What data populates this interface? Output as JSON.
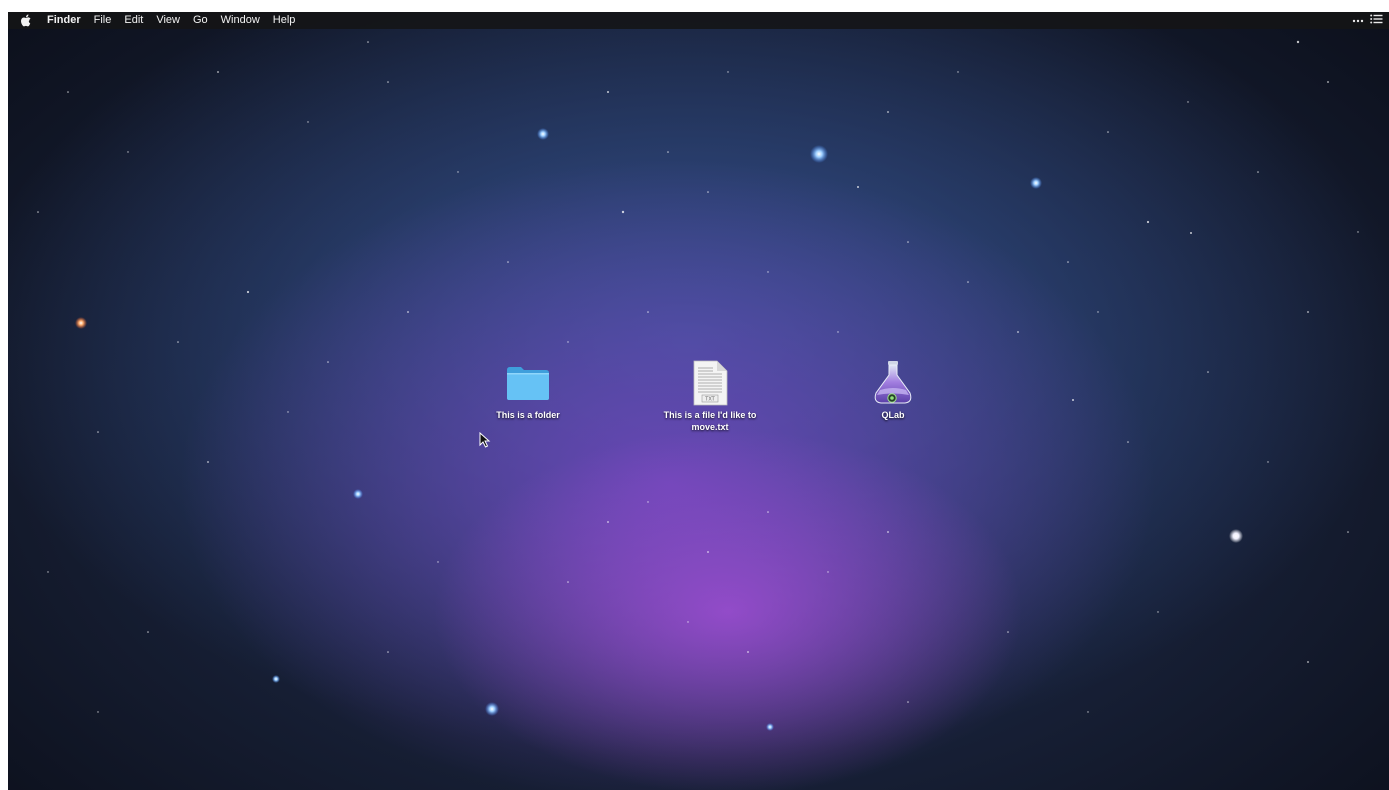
{
  "menubar": {
    "apple_icon": "apple-logo-icon",
    "items": [
      {
        "label": "Finder",
        "bold": true
      },
      {
        "label": "File"
      },
      {
        "label": "Edit"
      },
      {
        "label": "View"
      },
      {
        "label": "Go"
      },
      {
        "label": "Window"
      },
      {
        "label": "Help"
      }
    ],
    "right_icons": [
      "more-icon",
      "notification-center-icon"
    ]
  },
  "desktop": {
    "wallpaper": "galaxy-nebula",
    "items": [
      {
        "name": "This is a folder",
        "kind": "folder",
        "icon": "folder-icon"
      },
      {
        "name": "This is a file I'd like to move.txt",
        "kind": "text-file",
        "icon": "text-document-icon"
      },
      {
        "name": "QLab",
        "kind": "application",
        "icon": "qlab-flask-icon"
      }
    ]
  },
  "colors": {
    "menubar_bg": "#141416",
    "folder_blue": "#5ab9f0",
    "nebula_purple": "#a050dc",
    "sky_blue": "#22335a"
  }
}
